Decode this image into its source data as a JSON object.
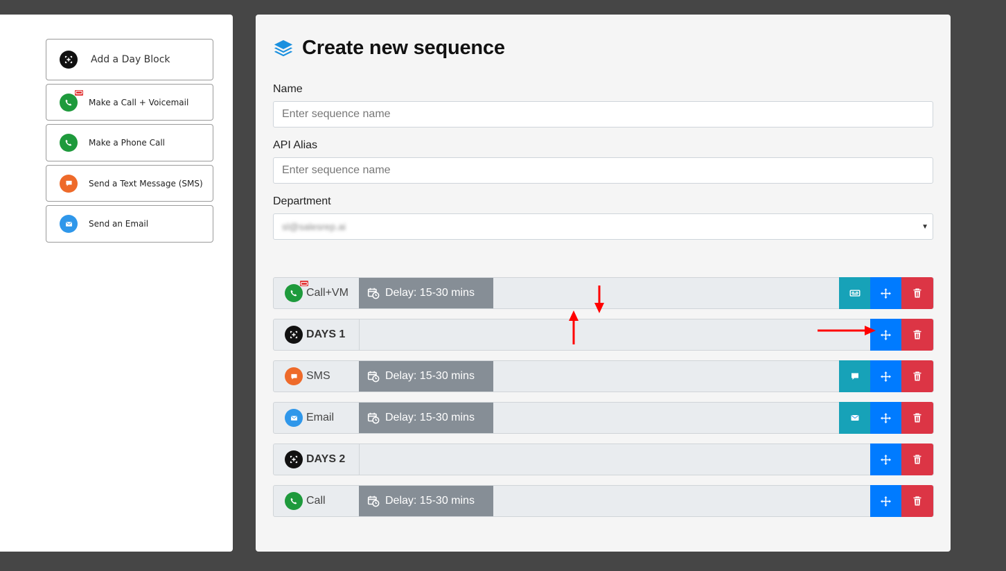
{
  "palette": {
    "add_day_block_label": "Add a Day Block",
    "items": [
      {
        "label": "Make a Call + Voicemail",
        "icon": "phone-voicemail-icon"
      },
      {
        "label": "Make a Phone Call",
        "icon": "phone-icon"
      },
      {
        "label": "Send a Text Message (SMS)",
        "icon": "chat-bubble-icon"
      },
      {
        "label": "Send an Email",
        "icon": "envelope-icon"
      }
    ]
  },
  "form": {
    "title": "Create new sequence",
    "name_label": "Name",
    "name_placeholder": "Enter sequence name",
    "api_alias_label": "API Alias",
    "api_alias_placeholder": "Enter sequence name",
    "department_label": "Department",
    "department_value": "sl@salesrep.ai"
  },
  "sequence": [
    {
      "type": "Call+VM",
      "delay": "Delay: 15-30 mins"
    },
    {
      "type": "DAYS 1"
    },
    {
      "type": "SMS",
      "delay": "Delay: 15-30 mins"
    },
    {
      "type": "Email",
      "delay": "Delay: 15-30 mins"
    },
    {
      "type": "DAYS 2"
    },
    {
      "type": "Call",
      "delay": "Delay: 15-30 mins"
    }
  ],
  "colors": {
    "background": "#464646",
    "call_green": "#1e9a3c",
    "sms_orange": "#ee6a2a",
    "email_blue": "#2f97ea",
    "teal": "#17a2b8",
    "move_blue": "#007bff",
    "delete_red": "#dc3545",
    "delay_gray": "#868e96",
    "annotation_red": "#ff0000"
  }
}
